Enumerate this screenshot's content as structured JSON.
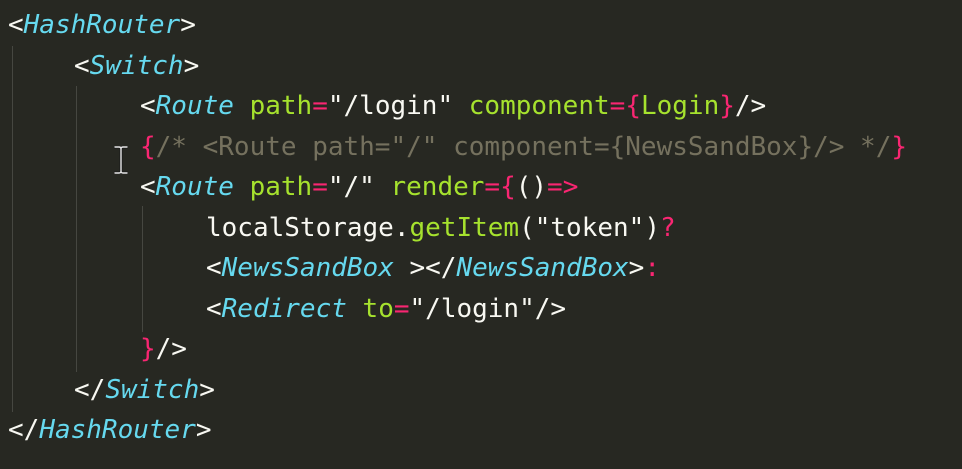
{
  "editor": {
    "theme": "monokai",
    "colors": {
      "background": "#272822",
      "text": "#f8f8f2",
      "tag": "#66d9ef",
      "attribute": "#a6e22e",
      "operator": "#f92672",
      "comment": "#75715e"
    },
    "lines": [
      {
        "tokens": [
          {
            "text": "<",
            "type": "punc"
          },
          {
            "text": "HashRouter",
            "type": "tag"
          },
          {
            "text": ">",
            "type": "punc"
          }
        ]
      },
      {
        "tokens": [
          {
            "text": "<",
            "type": "punc"
          },
          {
            "text": "Switch",
            "type": "tag"
          },
          {
            "text": ">",
            "type": "punc"
          }
        ]
      },
      {
        "tokens": [
          {
            "text": "<",
            "type": "punc"
          },
          {
            "text": "Route",
            "type": "tag"
          },
          {
            "text": " ",
            "type": "punc"
          },
          {
            "text": "path",
            "type": "attr"
          },
          {
            "text": "=",
            "type": "op"
          },
          {
            "text": "\"/login\"",
            "type": "str"
          },
          {
            "text": " ",
            "type": "punc"
          },
          {
            "text": "component",
            "type": "attr"
          },
          {
            "text": "=",
            "type": "op"
          },
          {
            "text": "{",
            "type": "op"
          },
          {
            "text": "Login",
            "type": "attr"
          },
          {
            "text": "}",
            "type": "op"
          },
          {
            "text": "/>",
            "type": "punc"
          }
        ]
      },
      {
        "tokens": [
          {
            "text": "{",
            "type": "op"
          },
          {
            "text": "/* <Route path=\"/\" component={NewsSandBox}/> */",
            "type": "comment"
          },
          {
            "text": "}",
            "type": "op"
          }
        ]
      },
      {
        "tokens": [
          {
            "text": "<",
            "type": "punc"
          },
          {
            "text": "Route",
            "type": "tag"
          },
          {
            "text": " ",
            "type": "punc"
          },
          {
            "text": "path",
            "type": "attr"
          },
          {
            "text": "=",
            "type": "op"
          },
          {
            "text": "\"/\"",
            "type": "str"
          },
          {
            "text": " ",
            "type": "punc"
          },
          {
            "text": "render",
            "type": "attr"
          },
          {
            "text": "=",
            "type": "op"
          },
          {
            "text": "{",
            "type": "op"
          },
          {
            "text": "()",
            "type": "punc"
          },
          {
            "text": "=>",
            "type": "op"
          }
        ]
      },
      {
        "tokens": [
          {
            "text": "localStorage",
            "type": "ident"
          },
          {
            "text": ".",
            "type": "punc"
          },
          {
            "text": "getItem",
            "type": "func"
          },
          {
            "text": "(",
            "type": "punc"
          },
          {
            "text": "\"token\"",
            "type": "str"
          },
          {
            "text": ")",
            "type": "punc"
          },
          {
            "text": "?",
            "type": "op"
          }
        ]
      },
      {
        "tokens": [
          {
            "text": "<",
            "type": "punc"
          },
          {
            "text": "NewsSandBox",
            "type": "tag"
          },
          {
            "text": " ></",
            "type": "punc"
          },
          {
            "text": "NewsSandBox",
            "type": "tag"
          },
          {
            "text": ">",
            "type": "punc"
          },
          {
            "text": ":",
            "type": "op"
          }
        ]
      },
      {
        "tokens": [
          {
            "text": "<",
            "type": "punc"
          },
          {
            "text": "Redirect",
            "type": "tag"
          },
          {
            "text": " ",
            "type": "punc"
          },
          {
            "text": "to",
            "type": "attr"
          },
          {
            "text": "=",
            "type": "op"
          },
          {
            "text": "\"/login\"",
            "type": "str"
          },
          {
            "text": "/>",
            "type": "punc"
          }
        ]
      },
      {
        "tokens": [
          {
            "text": "}",
            "type": "op"
          },
          {
            "text": "/>",
            "type": "punc"
          }
        ]
      },
      {
        "tokens": [
          {
            "text": "</",
            "type": "punc"
          },
          {
            "text": "Switch",
            "type": "tag"
          },
          {
            "text": ">",
            "type": "punc"
          }
        ]
      },
      {
        "tokens": [
          {
            "text": "</",
            "type": "punc"
          },
          {
            "text": "HashRouter",
            "type": "tag"
          },
          {
            "text": ">",
            "type": "punc"
          }
        ]
      }
    ]
  },
  "cursor": {
    "icon": "i-beam-cursor-icon"
  }
}
